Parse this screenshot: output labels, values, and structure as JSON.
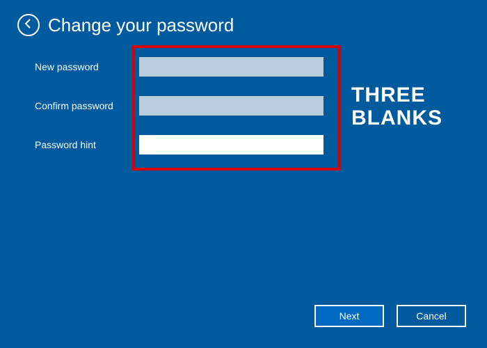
{
  "header": {
    "title": "Change your password"
  },
  "form": {
    "new_password": {
      "label": "New password",
      "value": ""
    },
    "confirm_password": {
      "label": "Confirm password",
      "value": ""
    },
    "password_hint": {
      "label": "Password hint",
      "value": ""
    }
  },
  "annotation": {
    "text": "THREE BLANKS",
    "box_color": "#d80000"
  },
  "buttons": {
    "next": "Next",
    "cancel": "Cancel"
  }
}
